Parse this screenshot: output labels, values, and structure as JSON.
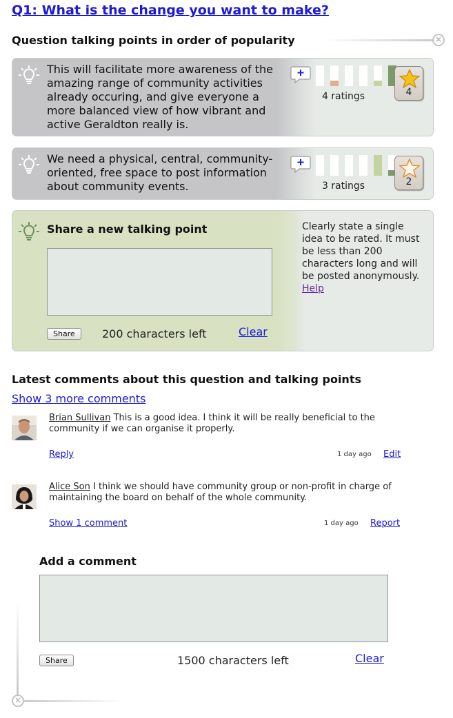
{
  "page": {
    "title": "Q1: What is the change you want to make?"
  },
  "talking_points": {
    "heading": "Question talking points in order of popularity",
    "items": [
      {
        "text": "This will facilitate more awareness of the amazing range of community activities already occuring, and give everyone a more balanced view of how vibrant and active Geraldton really is.",
        "ratings_label": "4 ratings",
        "star_count": "4",
        "star_state": "gold",
        "rating_distribution": [
          0,
          1,
          0,
          0,
          1,
          2
        ]
      },
      {
        "text": "We need a physical, central, community-oriented, free space to post information about community events.",
        "ratings_label": "3 ratings",
        "star_count": "2",
        "star_state": "outline",
        "rating_distribution": [
          0,
          0,
          0,
          0,
          2,
          1
        ]
      }
    ],
    "icons": {
      "idea": "lightbulb-icon",
      "add_comment": "plus-speech-bubble-icon",
      "star": "star-icon"
    },
    "bar_colors": [
      "#e0af8f",
      "#e0af8f",
      "#cfd7b1",
      "#cfd7b1",
      "#c4d4a0",
      "#7c9968"
    ]
  },
  "share": {
    "title": "Share a new talking point",
    "textarea_value": "",
    "button_label": "Share",
    "chars_left": "200 characters left",
    "clear_label": "Clear",
    "help_text": "Clearly state a single idea to be rated. It must be less than 200 characters long and will be posted anonymously.",
    "help_link": "Help"
  },
  "comments": {
    "heading": "Latest comments about this question and talking points",
    "show_more": "Show 3 more comments",
    "items": [
      {
        "author": "Brian Sullivan",
        "text": "This is a good idea. I think it will be really beneficial to the community if we can organise it properly.",
        "left_link": "Reply",
        "time": "1 day ago",
        "right_link": "Edit"
      },
      {
        "author": "Alice Son",
        "text": "I think we should have community group or non-profit in charge of maintaining the board on behalf of the whole community.",
        "left_link": "Show 1 comment",
        "time": "1 day ago",
        "right_link": "Report"
      }
    ]
  },
  "add_comment": {
    "title": "Add a comment",
    "textarea_value": "",
    "button_label": "Share",
    "chars_left": "1500 characters left",
    "clear_label": "Clear"
  },
  "colors": {
    "link": "#1a1ad8",
    "card_grey": "#c5c5c7",
    "card_light": "#e6ebe7",
    "share_green": "#d8e2c3",
    "bar_dark_green": "#7c9968",
    "bar_light_green": "#c4d4a0",
    "bar_peach": "#e0af8f",
    "star_gold": "#f5c21a"
  }
}
